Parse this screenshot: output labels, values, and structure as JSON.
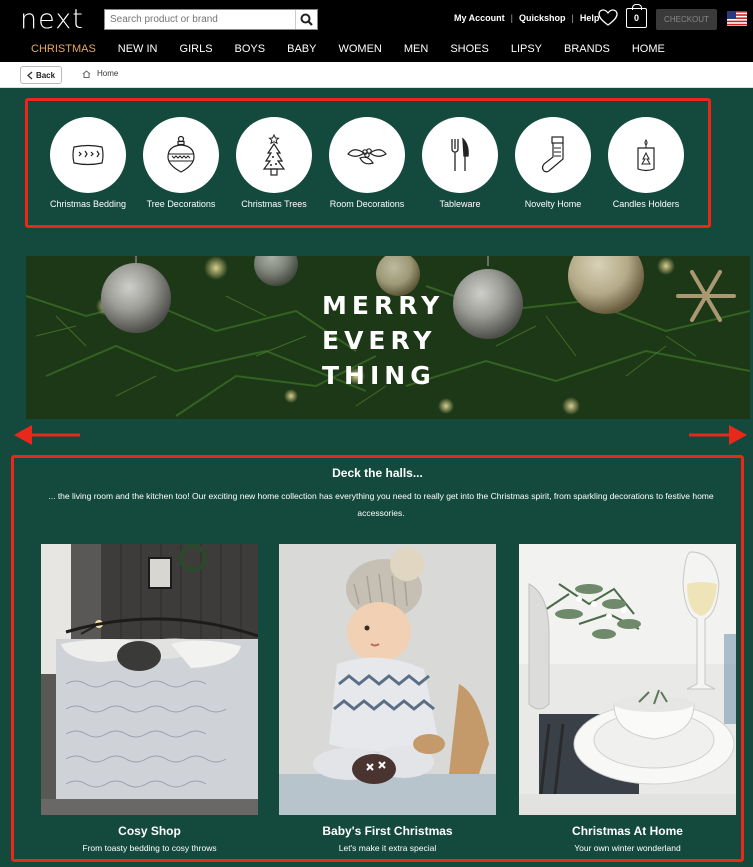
{
  "header": {
    "logo": "next",
    "search_placeholder": "Search product or brand",
    "links": [
      "My Account",
      "Quickshop",
      "Help"
    ],
    "bag_count": "0",
    "checkout_label": "CHECKOUT"
  },
  "nav": [
    "CHRISTMAS",
    "NEW IN",
    "GIRLS",
    "BOYS",
    "BABY",
    "WOMEN",
    "MEN",
    "SHOES",
    "LIPSY",
    "BRANDS",
    "HOME"
  ],
  "breadcrumb": {
    "back_label": "Back",
    "home_label": "Home"
  },
  "categories": [
    {
      "label": "Christmas Bedding",
      "icon": "pillow-icon"
    },
    {
      "label": "Tree Decorations",
      "icon": "bauble-icon"
    },
    {
      "label": "Christmas Trees",
      "icon": "tree-icon"
    },
    {
      "label": "Room Decorations",
      "icon": "holly-icon"
    },
    {
      "label": "Tableware",
      "icon": "cutlery-icon"
    },
    {
      "label": "Novelty Home",
      "icon": "stocking-icon"
    },
    {
      "label": "Candles Holders",
      "icon": "candle-icon"
    }
  ],
  "banner": {
    "lines": [
      "MERRY",
      "EVERY",
      "THING"
    ]
  },
  "deck": {
    "title": "Deck the halls...",
    "description": "... the living room and the kitchen too! Our exciting new home collection has everything you need to really get into the Christmas spirit, from sparkling decorations to festive home accessories."
  },
  "cards": [
    {
      "title": "Cosy Shop",
      "subtitle": "From toasty bedding to cosy throws"
    },
    {
      "title": "Baby's First Christmas",
      "subtitle": "Let's make it extra special"
    },
    {
      "title": "Christmas At Home",
      "subtitle": "Your own winter wonderland"
    }
  ],
  "colors": {
    "accent_nav": "#e5a960",
    "background_green": "#14493d",
    "highlight_red": "#e8281a"
  }
}
